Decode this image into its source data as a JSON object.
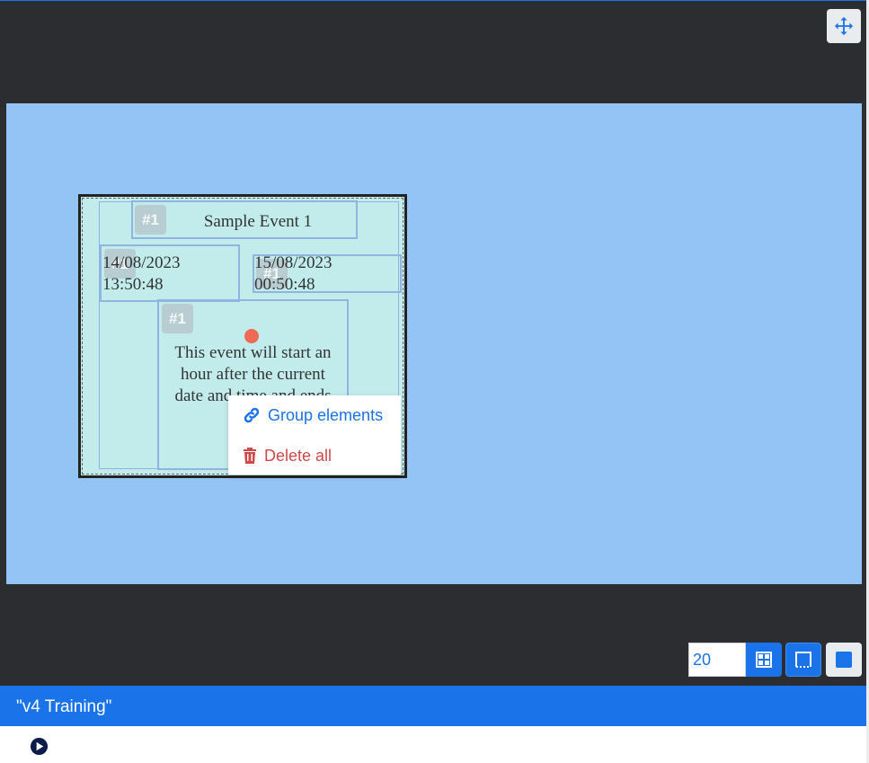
{
  "toolbar": {
    "move_icon": "move-arrows-icon"
  },
  "canvas": {
    "background_color": "#94c3f6",
    "element_background": "#c2ecec",
    "elements": {
      "title": {
        "badge": "#1",
        "text": "Sample Event 1"
      },
      "start": {
        "badge": "#1",
        "line1": "14/08/2023",
        "line2": "13:50:48"
      },
      "end": {
        "badge": "#1",
        "line1": "15/08/2023",
        "line2": "00:50:48"
      },
      "description": {
        "badge": "#1",
        "text": "This event will start an hour after the current date and time and ends 12 hou"
      }
    }
  },
  "context_menu": {
    "group_label": "Group elements",
    "group_icon": "link-icon",
    "delete_label": "Delete all",
    "delete_icon": "trash-icon"
  },
  "grid_controls": {
    "grid_size_value": "20",
    "grid_icon": "grid-icon",
    "snap_icon": "snap-frame-icon",
    "fill_icon": "fill-square-icon"
  },
  "header": {
    "title": "\"v4 Training\""
  },
  "player": {
    "play_icon": "play-icon"
  },
  "colors": {
    "accent": "#1a73e8",
    "editor_bg": "#2c2d30",
    "danger": "#d04848"
  }
}
